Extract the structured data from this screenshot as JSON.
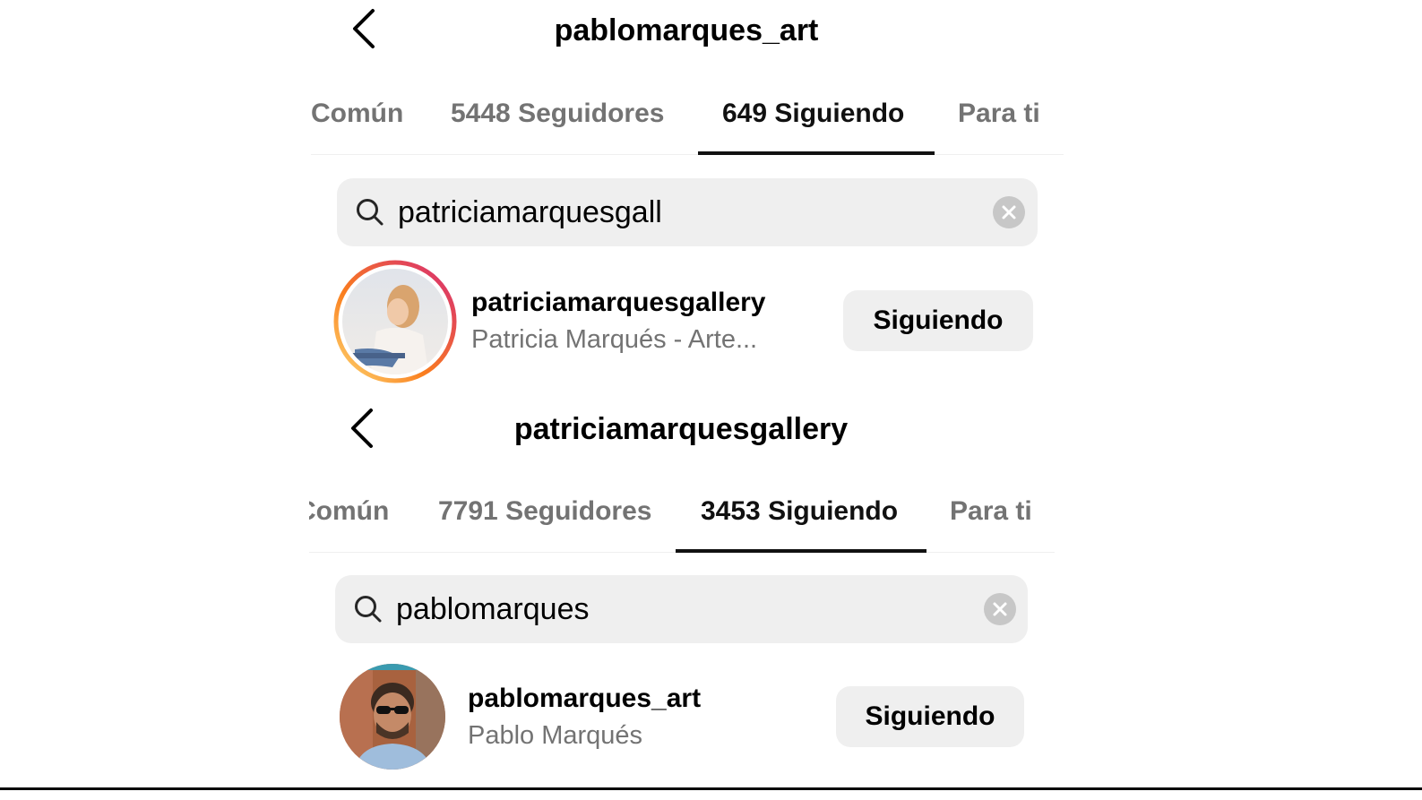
{
  "panel1": {
    "title": "pablomarques_art",
    "tabs": [
      {
        "label": "Común"
      },
      {
        "label": "5448 Seguidores"
      },
      {
        "label": "649 Siguiendo"
      },
      {
        "label": "Para ti"
      }
    ],
    "active_tab": 2,
    "search": {
      "value": "patriciamarquesgall"
    },
    "result": {
      "username": "patriciamarquesgallery",
      "fullname": "Patricia Marqués - Arte...",
      "button_label": "Siguiendo",
      "has_story_ring": true
    }
  },
  "panel2": {
    "title": "patriciamarquesgallery",
    "tabs": [
      {
        "label": "Común"
      },
      {
        "label": "7791 Seguidores"
      },
      {
        "label": "3453 Siguiendo"
      },
      {
        "label": "Para ti"
      }
    ],
    "active_tab": 2,
    "search": {
      "value": "pablomarques"
    },
    "result": {
      "username": "pablomarques_art",
      "fullname": "Pablo Marqués",
      "button_label": "Siguiendo",
      "has_story_ring": false
    }
  },
  "colors": {
    "story_ring_start": "#feda75",
    "story_ring_mid": "#fa7e1e",
    "story_ring_end": "#d62976",
    "secondary_text": "#737373",
    "field_bg": "#efefef"
  },
  "icons": {
    "back": "chevron-left-icon",
    "search": "search-icon",
    "clear": "clear-circle-x-icon"
  }
}
